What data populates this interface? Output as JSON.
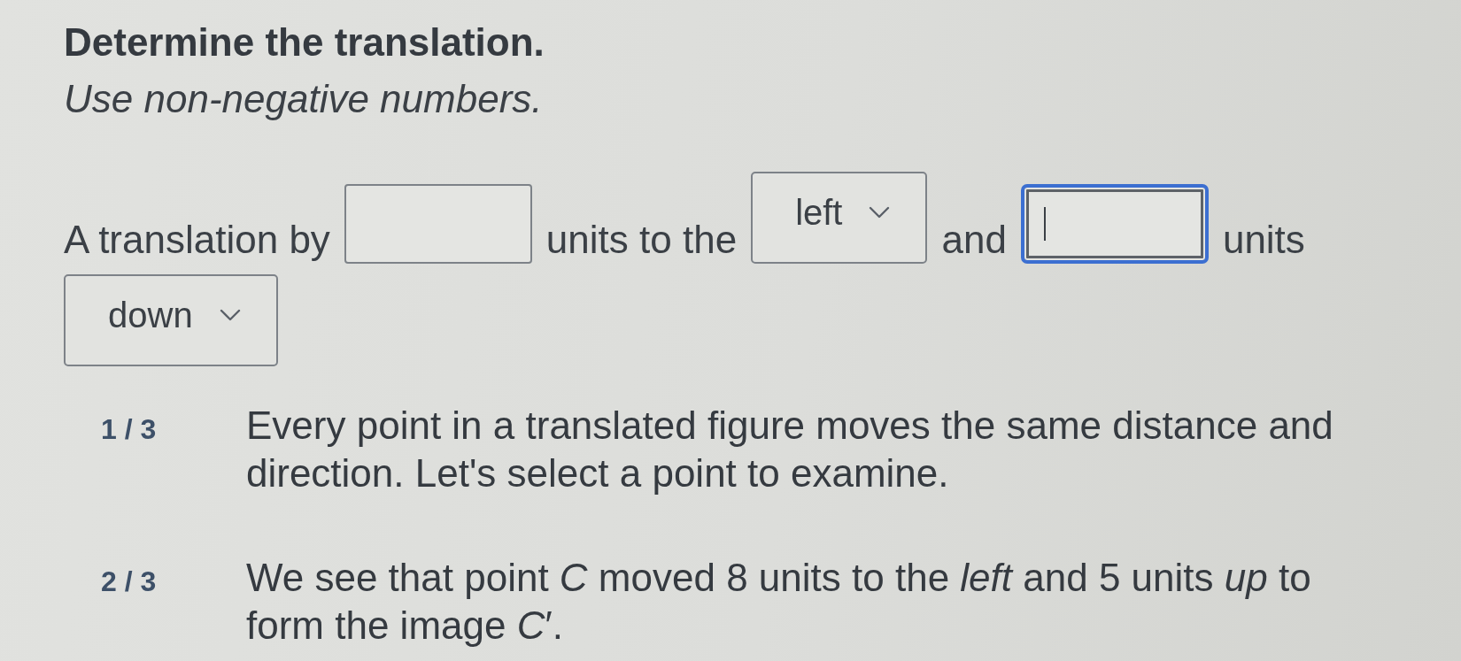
{
  "heading": {
    "title": "Determine the translation.",
    "instruction": "Use non-negative numbers."
  },
  "prompt": [
    {
      "kind": "text",
      "text": "A translation by"
    },
    {
      "kind": "input",
      "focused": false
    },
    {
      "kind": "text",
      "text": "units to the"
    },
    {
      "kind": "dropdown",
      "value": "left"
    },
    {
      "kind": "text",
      "text": "and"
    },
    {
      "kind": "input",
      "focused": true
    },
    {
      "kind": "text",
      "text": "units"
    },
    {
      "kind": "dropdown",
      "value": "down"
    }
  ],
  "steps": [
    {
      "counter": "1 / 3",
      "text": "Every point in a translated figure moves the same distance and direction. Let's select a point to examine."
    },
    {
      "counter": "2 / 3",
      "text": "We see that point *C* moved 8 units to the *left* and 5 units *up* to form the image *C*′."
    }
  ]
}
